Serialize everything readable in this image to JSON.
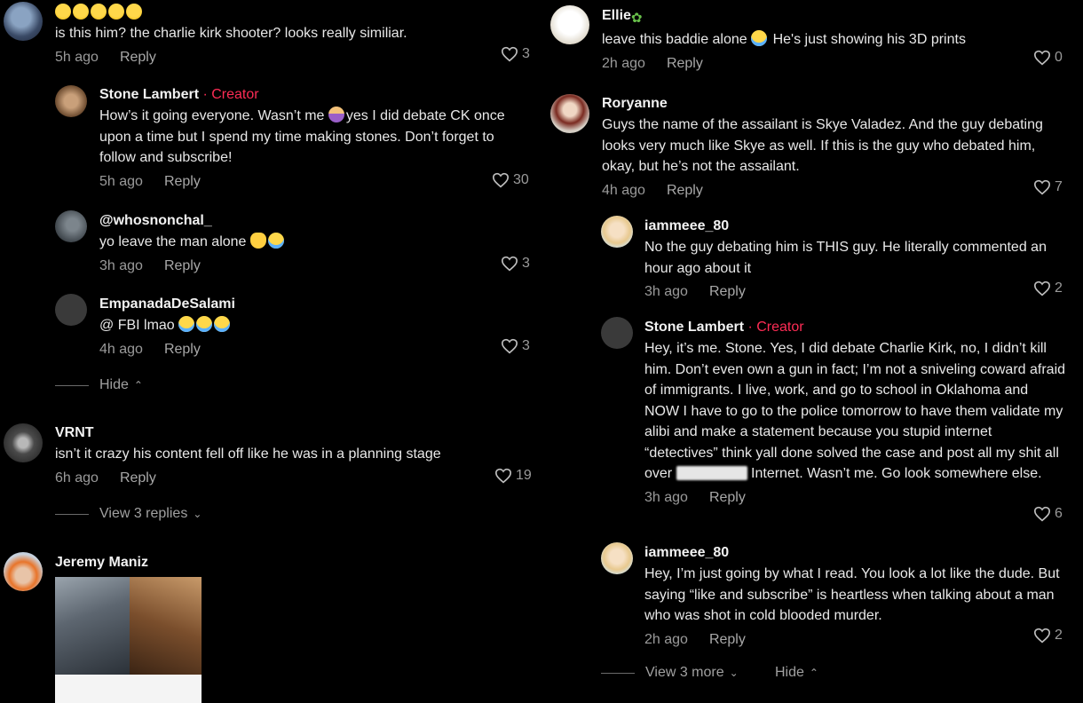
{
  "left": {
    "c1": {
      "emoji_count": 5,
      "text": "is this him? the charlie kirk shooter? looks really similiar.",
      "time": "5h ago",
      "reply": "Reply",
      "likes": "3"
    },
    "c2": {
      "name": "Stone Lambert",
      "badge": "· Creator",
      "text_a": "How’s it going everyone. Wasn’t me ",
      "text_b": "yes I did debate CK once upon a time but I spend my time making stones. Don’t forget to follow and subscribe!",
      "time": "5h ago",
      "reply": "Reply",
      "likes": "30"
    },
    "c3": {
      "name": "@whosnonchal_",
      "text": "yo leave the man alone ",
      "time": "3h ago",
      "reply": "Reply",
      "likes": "3"
    },
    "c4": {
      "name": "EmpanadaDeSalami",
      "text": "@ FBI lmao ",
      "time": "4h ago",
      "reply": "Reply",
      "likes": "3"
    },
    "hide": "Hide",
    "c5": {
      "name": "VRNT",
      "text": "isn’t it crazy his content fell off like he was in a planning stage",
      "time": "6h ago",
      "reply": "Reply",
      "likes": "19"
    },
    "view_replies": "View 3 replies",
    "c6": {
      "name": "Jeremy Maniz"
    }
  },
  "right": {
    "c1": {
      "name": "Ellie",
      "text": "leave this baddie alone ",
      "text_b": " He's just showing his 3D prints",
      "time": "2h ago",
      "reply": "Reply",
      "likes": "0"
    },
    "c2": {
      "name": "Roryanne",
      "text": "Guys the name of the assailant is Skye Valadez. And the guy debating looks very much like Skye as well. If this is the guy who debated him, okay, but he’s not the assailant.",
      "time": "4h ago",
      "reply": "Reply",
      "likes": "7"
    },
    "c3": {
      "name": "iammeee_80",
      "text": "No the guy debating him is THIS guy. He literally commented an hour ago about it",
      "time": "3h ago",
      "reply": "Reply",
      "likes": "2"
    },
    "c4": {
      "name": "Stone Lambert",
      "badge": "· Creator",
      "text_a": "Hey, it’s me. Stone. Yes, I did debate Charlie Kirk, no, I didn’t kill him. Don’t even own a gun in fact; I’m not a sniveling coward afraid of immigrants. I live, work, and go to school in Oklahoma and NOW I have to go to the police tomorrow to have them validate my alibi and make a statement because you stupid internet “detectives” think yall done solved the case and post all my shit all over ",
      "text_b": " Internet. Wasn’t me. Go look somewhere else.",
      "time": "3h ago",
      "reply": "Reply",
      "likes": "6"
    },
    "c5": {
      "name": "iammeee_80",
      "text": "Hey, I’m just going by what I read. You look a lot like the dude. But saying “like and subscribe” is heartless when talking about a man who was shot in cold blooded murder.",
      "time": "2h ago",
      "reply": "Reply",
      "likes": "2"
    },
    "view_more": "View 3 more",
    "hide": "Hide"
  },
  "colors": {
    "background": "#000000",
    "creator": "#fe2c55",
    "muted": "#9a9a9a"
  }
}
